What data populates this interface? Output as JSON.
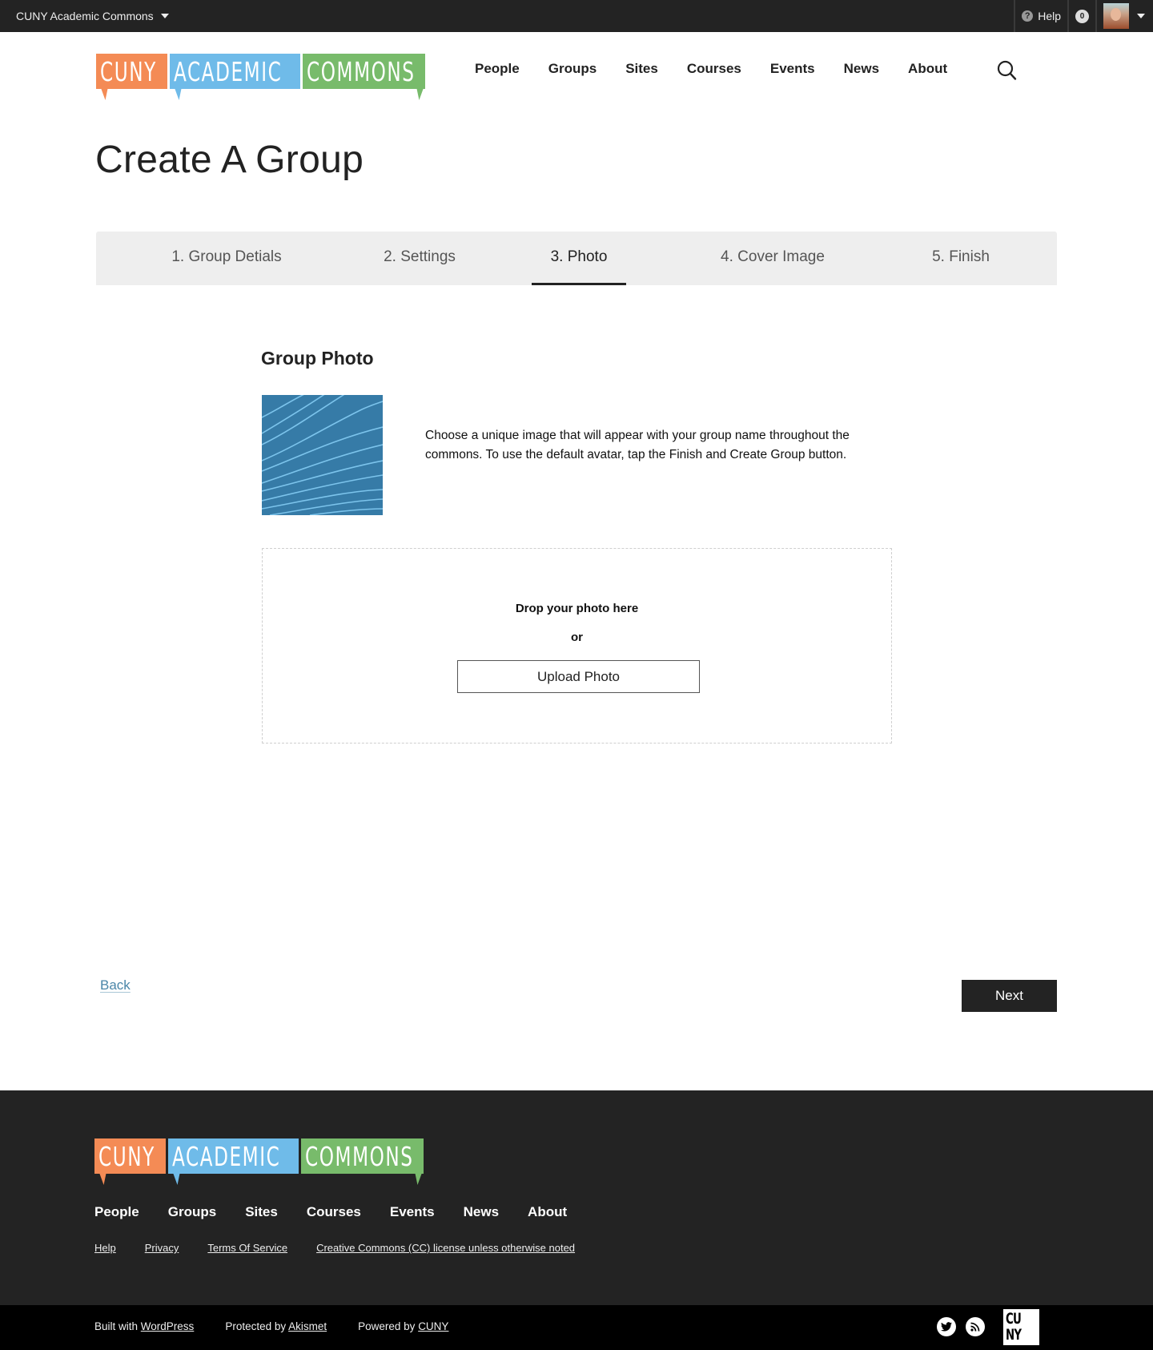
{
  "adminbar": {
    "site_name": "CUNY Academic Commons",
    "help_label": "Help",
    "notification_count": "0",
    "help_icon": "question-circle-icon",
    "caret_icon": "caret-down-icon"
  },
  "logo": {
    "parts": [
      "CUNY",
      "ACADEMIC",
      "COMMONS"
    ],
    "colors": {
      "orange": "#f48b55",
      "blue": "#6fbbe9",
      "green": "#78bb6b"
    }
  },
  "nav": {
    "items": [
      "People",
      "Groups",
      "Sites",
      "Courses",
      "Events",
      "News",
      "About"
    ],
    "search_icon": "search-icon"
  },
  "page": {
    "title": "Create A Group"
  },
  "steps": {
    "items": [
      {
        "label": "1. Group Detials",
        "active": false
      },
      {
        "label": "2. Settings",
        "active": false
      },
      {
        "label": "3. Photo",
        "active": true
      },
      {
        "label": "4. Cover Image",
        "active": false
      },
      {
        "label": "5. Finish",
        "active": false
      }
    ]
  },
  "photo": {
    "heading": "Group Photo",
    "description": "Choose a unique image that will appear with your group name throughout the commons. To use the default avatar, tap the Finish and Create Group button.",
    "drop_text": "Drop your photo here",
    "or_text": "or",
    "upload_label": "Upload Photo",
    "avatar_color": "#367ba7"
  },
  "actions": {
    "back_label": "Back",
    "next_label": "Next"
  },
  "footer": {
    "nav": [
      "People",
      "Groups",
      "Sites",
      "Courses",
      "Events",
      "News",
      "About"
    ],
    "links": [
      "Help",
      "Privacy",
      "Terms Of Service",
      "Creative Commons (CC) license unless otherwise noted"
    ],
    "credits": [
      {
        "prefix": "Built with ",
        "link": "WordPress"
      },
      {
        "prefix": "Protected by ",
        "link": "Akismet"
      },
      {
        "prefix": "Powered by ",
        "link": "CUNY"
      }
    ],
    "social_icons": [
      "twitter-icon",
      "rss-icon"
    ],
    "cuny_logo_lines": [
      "CU",
      "NY"
    ]
  }
}
